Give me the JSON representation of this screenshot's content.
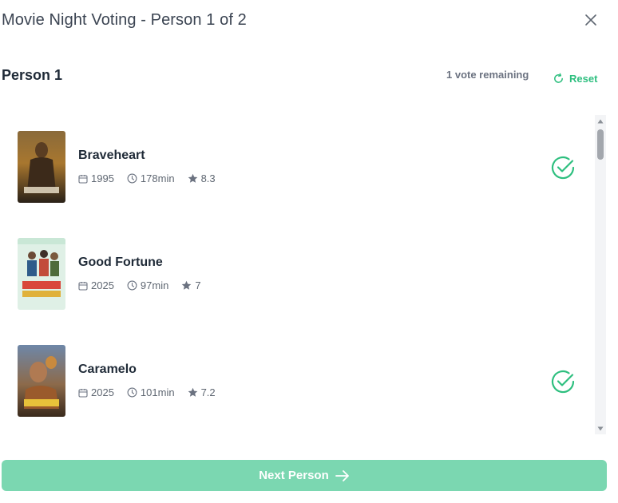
{
  "header": {
    "title": "Movie Night Voting - Person 1 of 2",
    "close_icon": "close-icon"
  },
  "person": {
    "name": "Person 1",
    "votes_remaining": "1 vote remaining",
    "reset_label": "Reset",
    "reset_icon": "refresh-icon"
  },
  "movies": [
    {
      "title": "Braveheart",
      "year": "1995",
      "runtime": "178min",
      "rating": "8.3",
      "selected": true
    },
    {
      "title": "Good Fortune",
      "year": "2025",
      "runtime": "97min",
      "rating": "7",
      "selected": false
    },
    {
      "title": "Caramelo",
      "year": "2025",
      "runtime": "101min",
      "rating": "7.2",
      "selected": true
    }
  ],
  "footer": {
    "next_label": "Next Person",
    "next_icon": "arrow-right-icon"
  },
  "colors": {
    "accent": "#2ebf7f",
    "button": "#7bd7b1",
    "text": "#1f2a37",
    "muted": "#6b7280"
  }
}
